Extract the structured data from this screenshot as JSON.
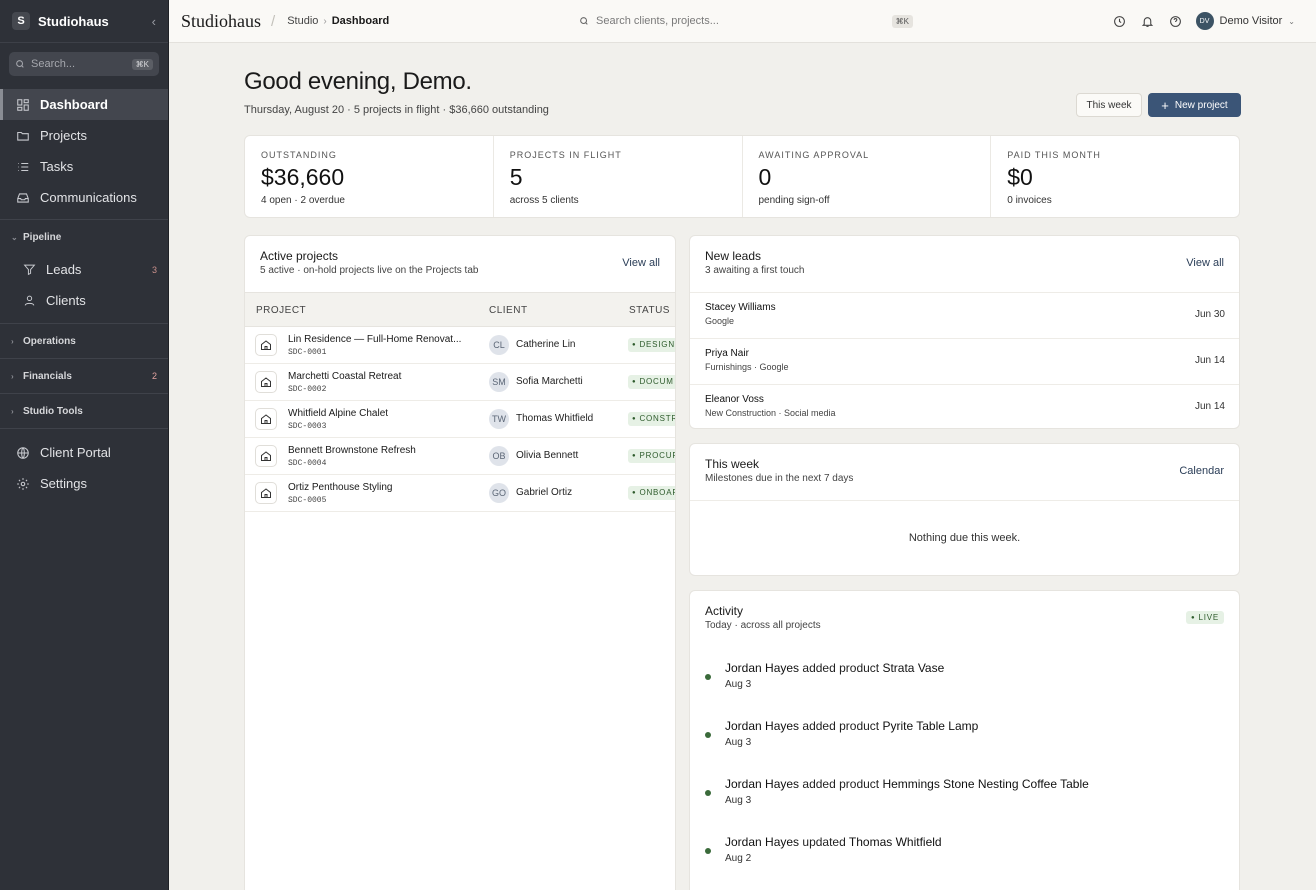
{
  "sidebar": {
    "logo_letter": "S",
    "brand": "Studiohaus",
    "search_placeholder": "Search...",
    "search_kbd": "⌘K",
    "items": [
      {
        "label": "Dashboard",
        "icon": "dashboard-icon",
        "active": true
      },
      {
        "label": "Projects",
        "icon": "folder-icon"
      },
      {
        "label": "Tasks",
        "icon": "list-icon"
      },
      {
        "label": "Communications",
        "icon": "inbox-icon"
      }
    ],
    "pipeline": {
      "label": "Pipeline",
      "items": [
        {
          "label": "Leads",
          "badge": "3"
        },
        {
          "label": "Clients"
        }
      ]
    },
    "groups": [
      {
        "label": "Operations"
      },
      {
        "label": "Financials",
        "badge": "2"
      },
      {
        "label": "Studio Tools"
      }
    ],
    "bottom": [
      {
        "label": "Client Portal"
      },
      {
        "label": "Settings"
      }
    ]
  },
  "topbar": {
    "logo": "Studiohaus",
    "crumb_root": "Studio",
    "crumb_current": "Dashboard",
    "search_placeholder": "Search clients, projects...",
    "search_kbd": "⌘K",
    "user_initials": "DV",
    "user_name": "Demo Visitor"
  },
  "header": {
    "greeting": "Good evening, Demo.",
    "subline": "Thursday, August 20 · 5 projects in flight · $36,660 outstanding",
    "week_button": "This week",
    "new_button": "New project"
  },
  "stats": [
    {
      "label": "OUTSTANDING",
      "value": "$36,660",
      "sub": "4 open · 2 overdue"
    },
    {
      "label": "PROJECTS IN FLIGHT",
      "value": "5",
      "sub": "across 5 clients"
    },
    {
      "label": "AWAITING APPROVAL",
      "value": "0",
      "sub": "pending sign-off"
    },
    {
      "label": "PAID THIS MONTH",
      "value": "$0",
      "sub": "0 invoices"
    }
  ],
  "projects": {
    "title": "Active projects",
    "subtitle": "5 active · on-hold projects live on the Projects tab",
    "link": "View all",
    "col_project": "PROJECT",
    "col_client": "CLIENT",
    "col_status": "STATUS",
    "rows": [
      {
        "name": "Lin Residence — Full-Home Renovat...",
        "code": "SDC-0001",
        "initials": "CL",
        "client": "Catherine Lin",
        "status": "DESIGN"
      },
      {
        "name": "Marchetti Coastal Retreat",
        "code": "SDC-0002",
        "initials": "SM",
        "client": "Sofia Marchetti",
        "status": "DOCUM"
      },
      {
        "name": "Whitfield Alpine Chalet",
        "code": "SDC-0003",
        "initials": "TW",
        "client": "Thomas Whitfield",
        "status": "CONSTR"
      },
      {
        "name": "Bennett Brownstone Refresh",
        "code": "SDC-0004",
        "initials": "OB",
        "client": "Olivia Bennett",
        "status": "PROCUR"
      },
      {
        "name": "Ortiz Penthouse Styling",
        "code": "SDC-0005",
        "initials": "GO",
        "client": "Gabriel Ortiz",
        "status": "ONBOAR"
      }
    ]
  },
  "leads": {
    "title": "New leads",
    "subtitle": "3 awaiting a first touch",
    "link": "View all",
    "rows": [
      {
        "name": "Stacey Williams",
        "source": "Google",
        "date": "Jun 30"
      },
      {
        "name": "Priya Nair",
        "source": "Furnishings · Google",
        "date": "Jun 14"
      },
      {
        "name": "Eleanor Voss",
        "source": "New Construction · Social media",
        "date": "Jun 14"
      }
    ]
  },
  "week": {
    "title": "This week",
    "subtitle": "Milestones due in the next 7 days",
    "link": "Calendar",
    "empty": "Nothing due this week."
  },
  "activity": {
    "title": "Activity",
    "subtitle": "Today · across all projects",
    "badge": "LIVE",
    "items": [
      {
        "actor": "Jordan Hayes",
        "verb": "added product",
        "object": "Strata Vase",
        "date": "Aug 3"
      },
      {
        "actor": "Jordan Hayes",
        "verb": "added product",
        "object": "Pyrite Table Lamp",
        "date": "Aug 3"
      },
      {
        "actor": "Jordan Hayes",
        "verb": "added product",
        "object": "Hemmings Stone Nesting Coffee Table",
        "date": "Aug 3"
      },
      {
        "actor": "Jordan Hayes",
        "verb": "updated",
        "object": "Thomas Whitfield",
        "date": "Aug 2"
      }
    ]
  },
  "colors": {
    "accent": "#3b5577",
    "sidebar": "#2e3138",
    "status_green": "#2e5b2c"
  }
}
